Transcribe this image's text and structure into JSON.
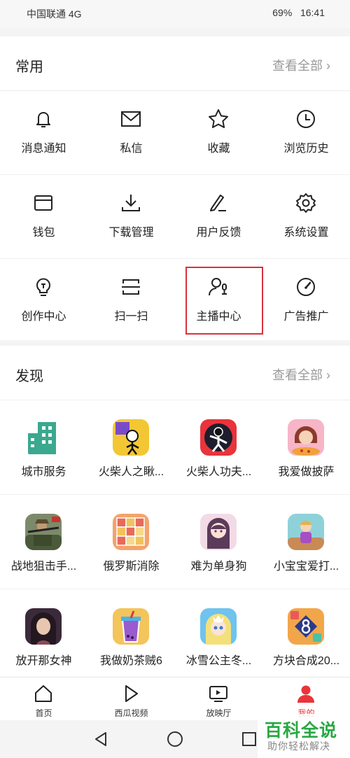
{
  "status_bar": {
    "carrier": "中国联通 4G",
    "battery": "69%",
    "time": "16:41"
  },
  "common": {
    "title": "常用",
    "more_label": "查看全部 ›",
    "items": [
      {
        "label": "消息通知",
        "icon": "bell-icon"
      },
      {
        "label": "私信",
        "icon": "mail-icon"
      },
      {
        "label": "收藏",
        "icon": "star-icon"
      },
      {
        "label": "浏览历史",
        "icon": "clock-icon"
      },
      {
        "label": "钱包",
        "icon": "wallet-icon"
      },
      {
        "label": "下载管理",
        "icon": "download-icon"
      },
      {
        "label": "用户反馈",
        "icon": "feedback-pen-icon"
      },
      {
        "label": "系统设置",
        "icon": "gear-icon"
      },
      {
        "label": "创作中心",
        "icon": "lightbulb-icon"
      },
      {
        "label": "扫一扫",
        "icon": "scan-icon"
      },
      {
        "label": "主播中心",
        "icon": "anchor-user-mic-icon"
      },
      {
        "label": "广告推广",
        "icon": "gauge-icon"
      }
    ]
  },
  "discover": {
    "title": "发现",
    "more_label": "查看全部 ›",
    "items": [
      {
        "label": "城市服务",
        "icon": "city-buildings-icon"
      },
      {
        "label": "火柴人之瞅...",
        "icon": "stickman-game-icon"
      },
      {
        "label": "火柴人功夫...",
        "icon": "stickman-kungfu-icon"
      },
      {
        "label": "我爱做披萨",
        "icon": "pizza-girl-icon"
      },
      {
        "label": "战地狙击手...",
        "icon": "sniper-soldier-icon"
      },
      {
        "label": "俄罗斯消除",
        "icon": "block-puzzle-icon"
      },
      {
        "label": "难为单身狗",
        "icon": "anime-girl-icon"
      },
      {
        "label": "小宝宝爱打...",
        "icon": "baby-room-icon"
      },
      {
        "label": "放开那女神",
        "icon": "goddess-portrait-icon"
      },
      {
        "label": "我做奶茶贼6",
        "icon": "milk-tea-icon"
      },
      {
        "label": "冰雪公主冬...",
        "icon": "ice-princess-icon"
      },
      {
        "label": "方块合成20...",
        "icon": "number-block-icon"
      }
    ]
  },
  "tabbar": {
    "tabs": [
      {
        "label": "首页",
        "icon": "home-icon"
      },
      {
        "label": "西瓜视频",
        "icon": "play-icon"
      },
      {
        "label": "放映厅",
        "icon": "tv-play-icon"
      },
      {
        "label": "我的",
        "icon": "user-icon"
      }
    ]
  },
  "watermark": {
    "title": "百科全说",
    "subtitle": "助你轻松解决"
  },
  "colors": {
    "accent_red": "#e8353a",
    "highlight_box": "#d9323a",
    "watermark_green": "#2aa843"
  }
}
